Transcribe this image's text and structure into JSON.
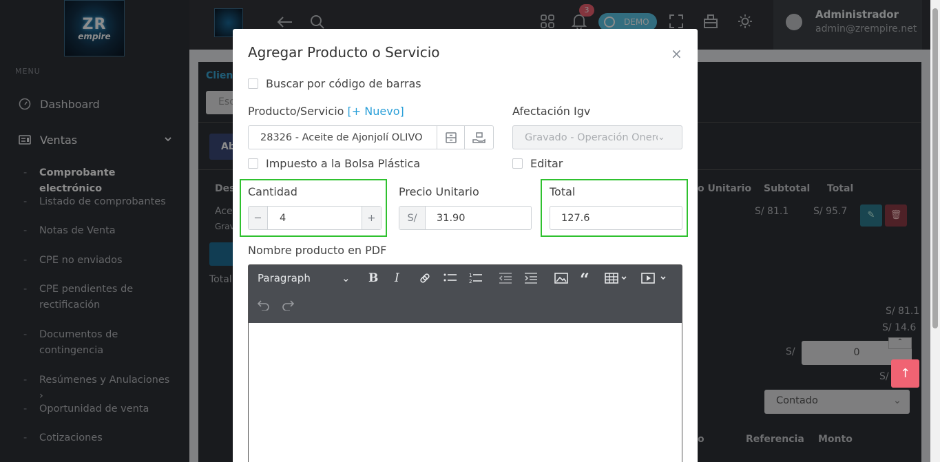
{
  "sidebar": {
    "logo_line1": "ZR",
    "logo_line2": "empire",
    "menu_label": "MENU",
    "items": [
      {
        "label": "Dashboard"
      },
      {
        "label": "Ventas"
      }
    ],
    "subitems": [
      {
        "label": "Comprobante electrónico",
        "active": true
      },
      {
        "label": "Listado de comprobantes"
      },
      {
        "label": "Notas de Venta"
      },
      {
        "label": "CPE no enviados"
      },
      {
        "label": "CPE pendientes de rectificación"
      },
      {
        "label": "Documentos de contingencia"
      },
      {
        "label": "Resúmenes y Anulaciones",
        "arrow": "›"
      },
      {
        "label": "Oportunidad de venta"
      },
      {
        "label": "Cotizaciones"
      }
    ]
  },
  "header": {
    "notification_count": "3",
    "demo_label": "DEMO",
    "user_name": "Administrador",
    "user_email": "admin@zrempire.net"
  },
  "background": {
    "client_label": "Clien",
    "search_placeholder": "Esc",
    "button_ab": "Ab",
    "table_headers": [
      "Des",
      "o Unitario",
      "Subtotal",
      "Total"
    ],
    "row_desc": "Ace",
    "row_sub": "Grav",
    "row_subtotal": "S/ 81.1",
    "row_total": "S/ 95.7",
    "total_label": "Total",
    "sum1": "S/ 81.1",
    "sum2": "S/ 14.6",
    "currency_s": "S/",
    "discount_value": "0",
    "currency_s2": "S/",
    "payment_select": "Contado",
    "footer_headers": [
      "o",
      "Referencia",
      "Monto"
    ]
  },
  "modal": {
    "title": "Agregar Producto o Servicio",
    "barcode_label": "Buscar por código de barras",
    "product_label": "Producto/Servicio",
    "new_link": "[+ Nuevo]",
    "product_value": "28326 - Aceite de Ajonjolí OLIVO",
    "igv_label": "Afectación Igv",
    "igv_value": "Gravado - Operación Onerosa",
    "bag_tax_label": "Impuesto a la Bolsa Plástica",
    "edit_label": "Editar",
    "qty_label": "Cantidad",
    "qty_value": "4",
    "unit_price_label": "Precio Unitario",
    "currency_prefix": "S/",
    "unit_price_value": "31.90",
    "total_label": "Total",
    "total_value": "127.6",
    "pdf_name_label": "Nombre producto en PDF",
    "editor_format": "Paragraph"
  }
}
